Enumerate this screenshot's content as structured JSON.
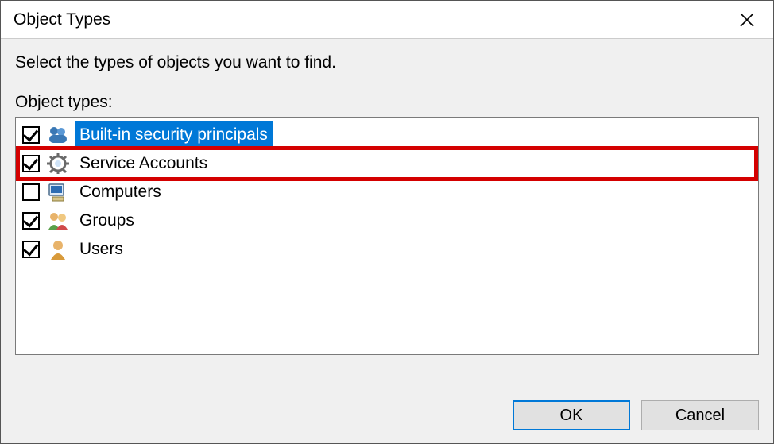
{
  "window": {
    "title": "Object Types"
  },
  "instruction": "Select the types of objects you want to find.",
  "list_label": "Object types:",
  "items": [
    {
      "label": "Built-in security principals",
      "checked": true,
      "selected": true,
      "highlighted": false,
      "icon": "principals-icon"
    },
    {
      "label": "Service Accounts",
      "checked": true,
      "selected": false,
      "highlighted": true,
      "icon": "service-account-icon"
    },
    {
      "label": "Computers",
      "checked": false,
      "selected": false,
      "highlighted": false,
      "icon": "computers-icon"
    },
    {
      "label": "Groups",
      "checked": true,
      "selected": false,
      "highlighted": false,
      "icon": "groups-icon"
    },
    {
      "label": "Users",
      "checked": true,
      "selected": false,
      "highlighted": false,
      "icon": "users-icon"
    }
  ],
  "buttons": {
    "ok": "OK",
    "cancel": "Cancel"
  }
}
